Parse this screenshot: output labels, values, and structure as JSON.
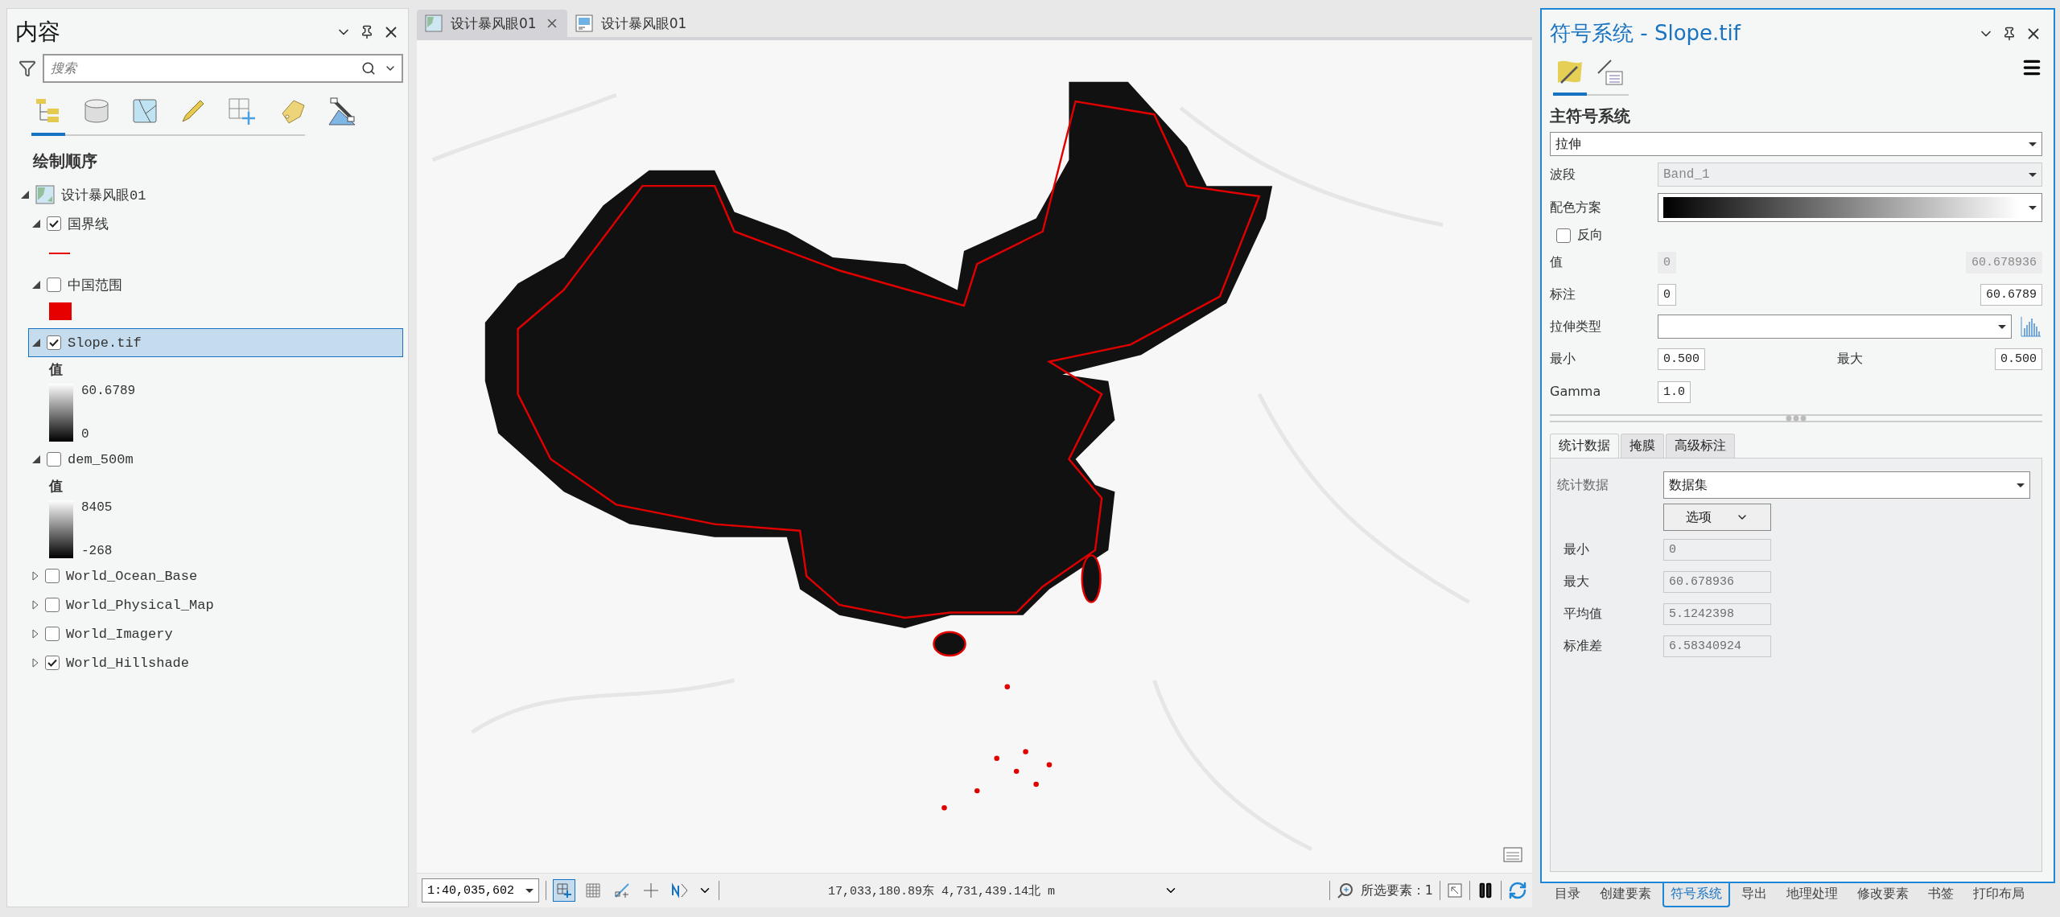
{
  "contents_pane": {
    "title": "内容",
    "search": {
      "placeholder": "搜索"
    },
    "view_tabs": [
      {
        "kind": "order",
        "selected": true
      },
      {
        "kind": "database",
        "selected": false
      },
      {
        "kind": "map",
        "selected": false
      },
      {
        "kind": "pencil",
        "selected": false
      },
      {
        "kind": "grid",
        "selected": false
      },
      {
        "kind": "tag",
        "selected": false
      },
      {
        "kind": "satellite",
        "selected": false
      }
    ],
    "heading": "绘制顺序",
    "map_item": {
      "label": "设计暴风眼01",
      "expanded": true,
      "children": [
        {
          "label": "国界线",
          "checked": true,
          "expanded": true,
          "selected": false,
          "legend": {
            "kind": "line"
          }
        },
        {
          "label": "中国范围",
          "checked": false,
          "expanded": true,
          "selected": false,
          "legend": {
            "kind": "fill"
          }
        },
        {
          "label": "Slope.tif",
          "checked": true,
          "expanded": true,
          "selected": true,
          "legend": {
            "kind": "ramp",
            "heading": "值",
            "high": "60.6789",
            "low": "0"
          }
        },
        {
          "label": "dem_500m",
          "checked": false,
          "expanded": true,
          "selected": false,
          "legend": {
            "kind": "ramp",
            "heading": "值",
            "high": "8405",
            "low": "-268"
          }
        },
        {
          "label": "World_Ocean_Base",
          "checked": false,
          "expanded": false,
          "selected": false
        },
        {
          "label": "World_Physical_Map",
          "checked": false,
          "expanded": false,
          "selected": false
        },
        {
          "label": "World_Imagery",
          "checked": false,
          "expanded": false,
          "selected": false
        },
        {
          "label": "World_Hillshade",
          "checked": true,
          "expanded": false,
          "selected": false
        }
      ]
    }
  },
  "map_view": {
    "tabs": [
      {
        "label": "设计暴风眼01",
        "kind": "map",
        "selected": true
      },
      {
        "label": "设计暴风眼01",
        "kind": "layout",
        "selected": false
      }
    ],
    "status_bar": {
      "scale": "1:40,035,602",
      "coordinates": "17,033,180.89东 4,731,439.14北 m",
      "selected_features": "所选要素：1"
    }
  },
  "symbology_pane": {
    "title": "符号系统 - Slope.tif",
    "tabs": [
      {
        "kind": "primary",
        "selected": true
      },
      {
        "kind": "vary",
        "selected": false
      }
    ],
    "heading": "主符号系统",
    "renderer": "拉伸",
    "band": {
      "label": "波段",
      "value": "Band_1",
      "disabled": true
    },
    "color_scheme": {
      "label": "配色方案"
    },
    "invert": {
      "label": "反向",
      "checked": false
    },
    "values": {
      "label": "值",
      "min": "0",
      "max": "60.678936"
    },
    "labels": {
      "label": "标注",
      "min": "0",
      "max": "60.6789"
    },
    "stretch_type": {
      "label": "拉伸类型"
    },
    "min": {
      "label": "最小",
      "value": "0.500"
    },
    "max": {
      "label": "最大",
      "value": "0.500"
    },
    "gamma": {
      "label": "Gamma",
      "value": "1.0"
    },
    "sub_tabs": [
      {
        "label": "统计数据",
        "selected": true
      },
      {
        "label": "掩膜",
        "selected": false
      },
      {
        "label": "高级标注",
        "selected": false
      }
    ],
    "statistics": {
      "label": "统计数据",
      "value": "数据集",
      "options": "选项",
      "rows": [
        {
          "label": "最小",
          "value": "0"
        },
        {
          "label": "最大",
          "value": "60.678936"
        },
        {
          "label": "平均值",
          "value": "5.1242398"
        },
        {
          "label": "标准差",
          "value": "6.58340924"
        }
      ]
    }
  },
  "dock_tabs": [
    {
      "label": "目录",
      "selected": false
    },
    {
      "label": "创建要素",
      "selected": false
    },
    {
      "label": "符号系统",
      "selected": true
    },
    {
      "label": "导出",
      "selected": false
    },
    {
      "label": "地理处理",
      "selected": false
    },
    {
      "label": "修改要素",
      "selected": false
    },
    {
      "label": "书签",
      "selected": false
    },
    {
      "label": "打印布局",
      "selected": false
    }
  ]
}
